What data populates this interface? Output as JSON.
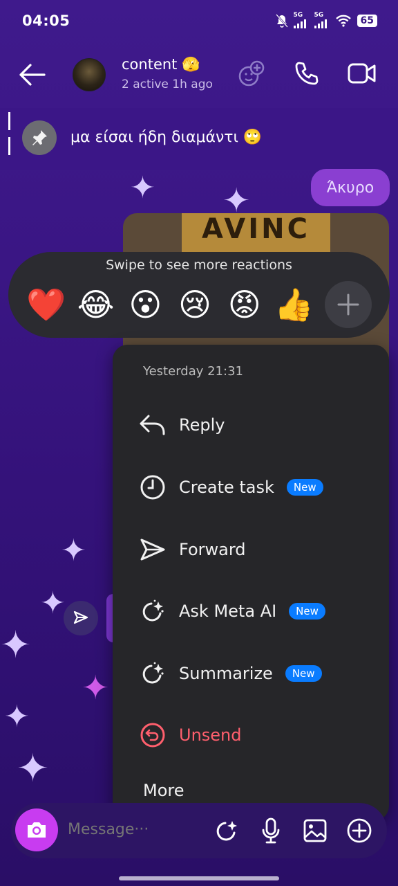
{
  "status_bar": {
    "time": "04:05",
    "signal_1": "5G",
    "signal_2": "5G",
    "battery": "65"
  },
  "header": {
    "name": "content 🫣",
    "subtitle": "2 active 1h ago",
    "icons": [
      "back-arrow-icon",
      "add-people-icon",
      "phone-icon",
      "video-camera-icon"
    ]
  },
  "pinned": {
    "text": "μα είσαι ήδη διαμάντι 🙄"
  },
  "chat": {
    "cancel_bubble": "Άκυρο",
    "media_poster_text": "AVINC"
  },
  "reactions": {
    "title": "Swipe to see more reactions",
    "emojis": [
      "❤️",
      "😂",
      "😮",
      "😢",
      "😡",
      "👍"
    ]
  },
  "menu": {
    "timestamp": "Yesterday 21:31",
    "items": [
      {
        "label": "Reply",
        "icon": "reply-icon"
      },
      {
        "label": "Create task",
        "icon": "clock-icon",
        "badge": "New"
      },
      {
        "label": "Forward",
        "icon": "send-icon"
      },
      {
        "label": "Ask Meta AI",
        "icon": "meta-ai-icon",
        "badge": "New"
      },
      {
        "label": "Summarize",
        "icon": "meta-ai-icon",
        "badge": "New"
      },
      {
        "label": "Unsend",
        "icon": "undo-circle-icon"
      }
    ],
    "more": "More",
    "accent_badge": "#0a7cff",
    "danger_color": "#ff5f6d"
  },
  "composer": {
    "placeholder": "Message···"
  }
}
